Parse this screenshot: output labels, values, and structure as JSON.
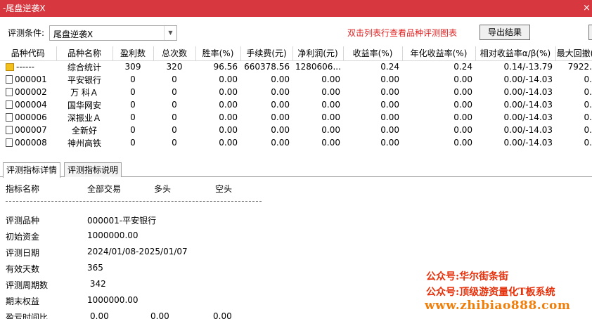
{
  "window": {
    "title": "-尾盘逆袭X",
    "close_label": "×"
  },
  "conditions": {
    "label": "评测条件:",
    "selected": "尾盘逆袭X",
    "hint": "双击列表行查看品种评测图表",
    "export_label": "导出结果"
  },
  "table": {
    "columns": [
      "品种代码",
      "品种名称",
      "盈利数",
      "总次数",
      "胜率(%)",
      "手续费(元)",
      "净利润(元)",
      "收益率(%)",
      "年化收益率(%)",
      "相对收益率α/β(%)",
      "最大回撤("
    ],
    "rows": [
      [
        "------",
        "综合统计",
        "309",
        "320",
        "96.56",
        "660378.56",
        "1280606...",
        "0.24",
        "0.24",
        "0.14/-13.79",
        "7922."
      ],
      [
        "000001",
        "平安银行",
        "0",
        "0",
        "0.00",
        "0.00",
        "0.00",
        "0.00",
        "0.00",
        "0.00/-14.03",
        "0."
      ],
      [
        "000002",
        "万 科Ａ",
        "0",
        "0",
        "0.00",
        "0.00",
        "0.00",
        "0.00",
        "0.00",
        "0.00/-14.03",
        "0."
      ],
      [
        "000004",
        "国华网安",
        "0",
        "0",
        "0.00",
        "0.00",
        "0.00",
        "0.00",
        "0.00",
        "0.00/-14.03",
        "0."
      ],
      [
        "000006",
        "深振业Ａ",
        "0",
        "0",
        "0.00",
        "0.00",
        "0.00",
        "0.00",
        "0.00",
        "0.00/-14.03",
        "0."
      ],
      [
        "000007",
        "全新好",
        "0",
        "0",
        "0.00",
        "0.00",
        "0.00",
        "0.00",
        "0.00",
        "0.00/-14.03",
        "0."
      ],
      [
        "000008",
        "神州高铁",
        "0",
        "0",
        "0.00",
        "0.00",
        "0.00",
        "0.00",
        "0.00",
        "0.00/-14.03",
        "0."
      ]
    ]
  },
  "tabs": [
    "评测指标详情",
    "评测指标说明"
  ],
  "detail": {
    "header": {
      "name": "指标名称",
      "all": "全部交易",
      "long": "多头",
      "short": "空头"
    },
    "fields": [
      {
        "key": "评测品种",
        "value": "000001-平安银行"
      },
      {
        "key": "初始资金",
        "value": "1000000.00"
      },
      {
        "key": "评测日期",
        "value": "2024/01/08-2025/01/07"
      },
      {
        "key": "有效天数",
        "value": "365"
      },
      {
        "key": "评测周期数",
        "value": " 342"
      },
      {
        "key": "期末权益",
        "value": "1000000.00"
      }
    ],
    "last_row": {
      "key": "盈亏时间比",
      "all": "0.00",
      "long": "0.00",
      "short": "0.00"
    }
  },
  "watermark": {
    "line1": "公众号:华尔街条街",
    "line2": "公众号:顶级游资量化T板系统",
    "line3": "www.zhibiao888.com"
  },
  "colors": {
    "titlebar": "#d7373e",
    "hint": "#e32020",
    "watermark_red": "#e6300a",
    "watermark_orange": "#f07e0a"
  },
  "icons": {
    "summary_row": "folder-icon",
    "data_row": "document-icon",
    "dropdown": "chevron-down-icon"
  }
}
